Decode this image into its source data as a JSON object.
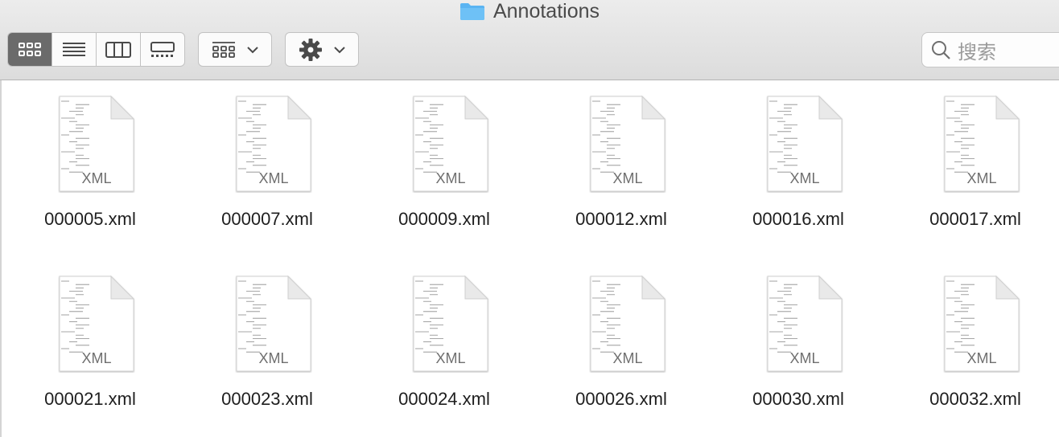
{
  "window": {
    "title": "Annotations"
  },
  "toolbar": {
    "view_modes": [
      {
        "name": "icon-view",
        "active": true
      },
      {
        "name": "list-view",
        "active": false
      },
      {
        "name": "column-view",
        "active": false
      },
      {
        "name": "gallery-view",
        "active": false
      }
    ],
    "group_by_icon": "group-grid-icon",
    "action_icon": "gear-icon"
  },
  "search": {
    "placeholder": "搜索"
  },
  "file_type_label": "XML",
  "files": [
    "000005.xml",
    "000007.xml",
    "000009.xml",
    "000012.xml",
    "000016.xml",
    "000017.xml",
    "000021.xml",
    "000023.xml",
    "000024.xml",
    "000026.xml",
    "000030.xml",
    "000032.xml"
  ],
  "colors": {
    "active_segment": "#6b6b6b",
    "folder_blue": "#5ab4f2"
  }
}
